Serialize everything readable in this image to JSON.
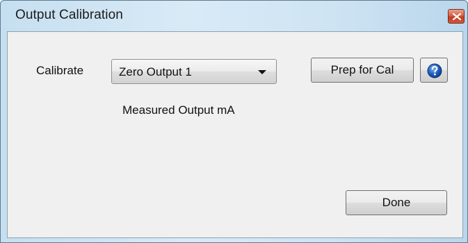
{
  "window": {
    "title": "Output Calibration",
    "close_icon": "close-icon"
  },
  "form": {
    "calibrate_label": "Calibrate",
    "calibrate_selected": "Zero Output 1",
    "measured_label": "Measured Output mA",
    "prep_button": "Prep for Cal",
    "help_icon": "help-icon",
    "done_button": "Done"
  },
  "colors": {
    "title_gradient_start": "#c6dff0",
    "close_red": "#c43d22",
    "client_bg": "#f0f0f0",
    "help_blue": "#1f5fbf"
  }
}
